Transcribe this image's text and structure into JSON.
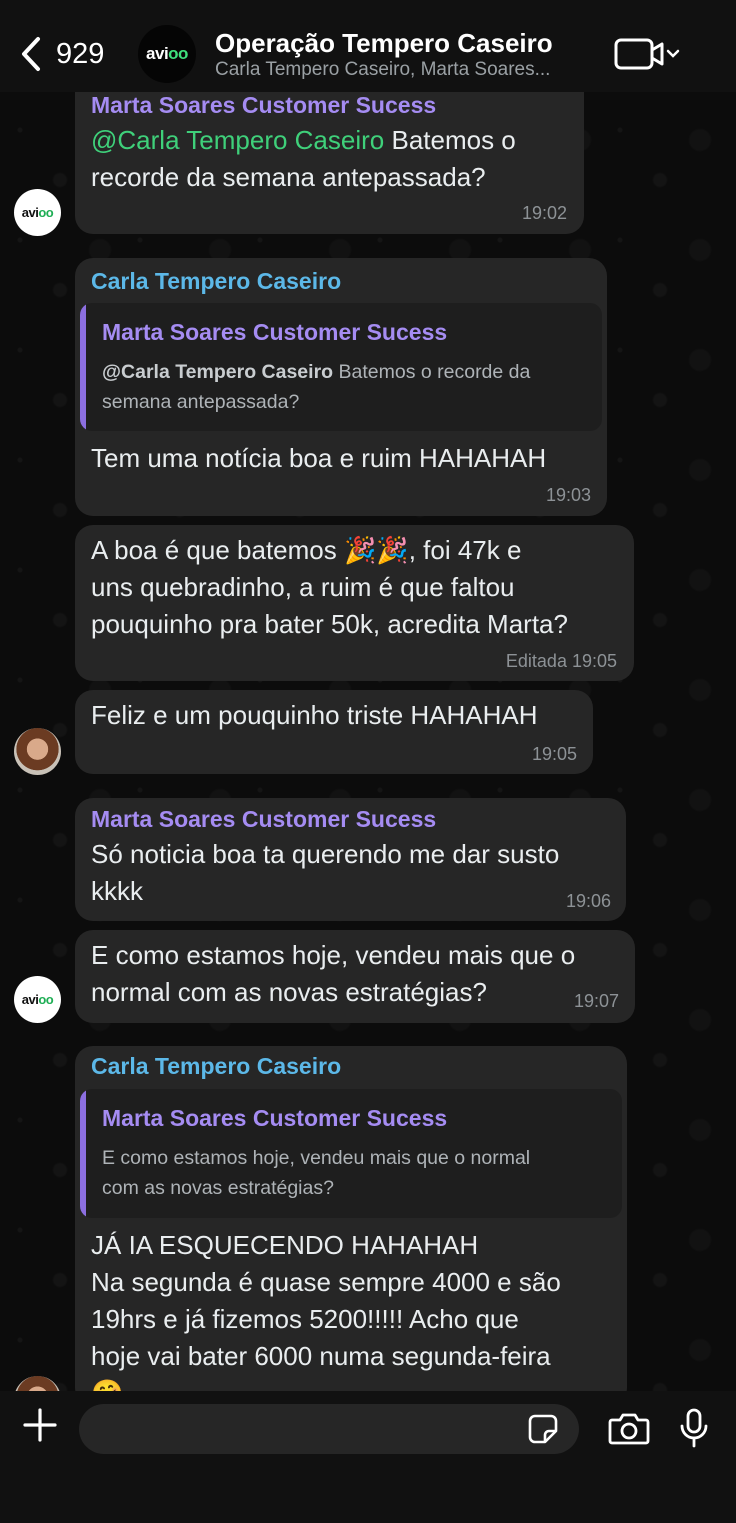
{
  "header": {
    "back_count": "929",
    "title": "Operação Tempero Caseiro",
    "subtitle": "Carla Tempero Caseiro, Marta Soares...",
    "logo_part1": "avi",
    "logo_part2": "oo"
  },
  "messages": [
    {
      "sender": "Marta Soares Customer Sucess",
      "mention": "@Carla Tempero Caseiro",
      "text_line1_rest": " Batemos o",
      "text_line2": "recorde da semana antepassada?",
      "time": "19:02"
    },
    {
      "sender": "Carla Tempero Caseiro",
      "quote_sender": "Marta Soares Customer Sucess",
      "quote_mention": "@Carla Tempero Caseiro",
      "quote_line1_rest": " Batemos o recorde da",
      "quote_line2": "semana antepassada?",
      "text": "Tem uma notícia boa e ruim HAHAHAH",
      "time": "19:03"
    },
    {
      "line1_a": "A boa é que batemos ",
      "line1_emoji": "🎉🎉",
      "line1_b": ", foi 47k e",
      "line2": "uns quebradinho, a ruim é que faltou",
      "line3": "pouquinho pra bater 50k, acredita Marta?",
      "edited_time": "Editada 19:05"
    },
    {
      "text": "Feliz e um pouquinho triste HAHAHAH",
      "time": "19:05"
    },
    {
      "sender": "Marta Soares Customer Sucess",
      "line1": "Só noticia boa ta querendo me dar susto",
      "line2": "kkkk",
      "time": "19:06"
    },
    {
      "line1": "E como estamos hoje, vendeu mais que o",
      "line2": "normal com as novas estratégias?",
      "time": "19:07"
    },
    {
      "sender": "Carla Tempero Caseiro",
      "quote_sender": "Marta Soares Customer Sucess",
      "quote_line1": "E como estamos hoje, vendeu mais que o normal",
      "quote_line2": "com as novas estratégias?",
      "line1": "JÁ IA ESQUECENDO HAHAHAH",
      "line2": "Na segunda é quase sempre 4000 e são",
      "line3": "19hrs e já fizemos 5200!!!!! Acho que",
      "line4": "hoje vai bater 6000 numa segunda-feira",
      "line5_emoji": "🤗"
    }
  ],
  "icons": {
    "back": "chevron-left-icon",
    "video": "video-camera-icon",
    "plus": "plus-icon",
    "sticker": "sticker-icon",
    "camera": "camera-icon",
    "mic": "microphone-icon"
  }
}
